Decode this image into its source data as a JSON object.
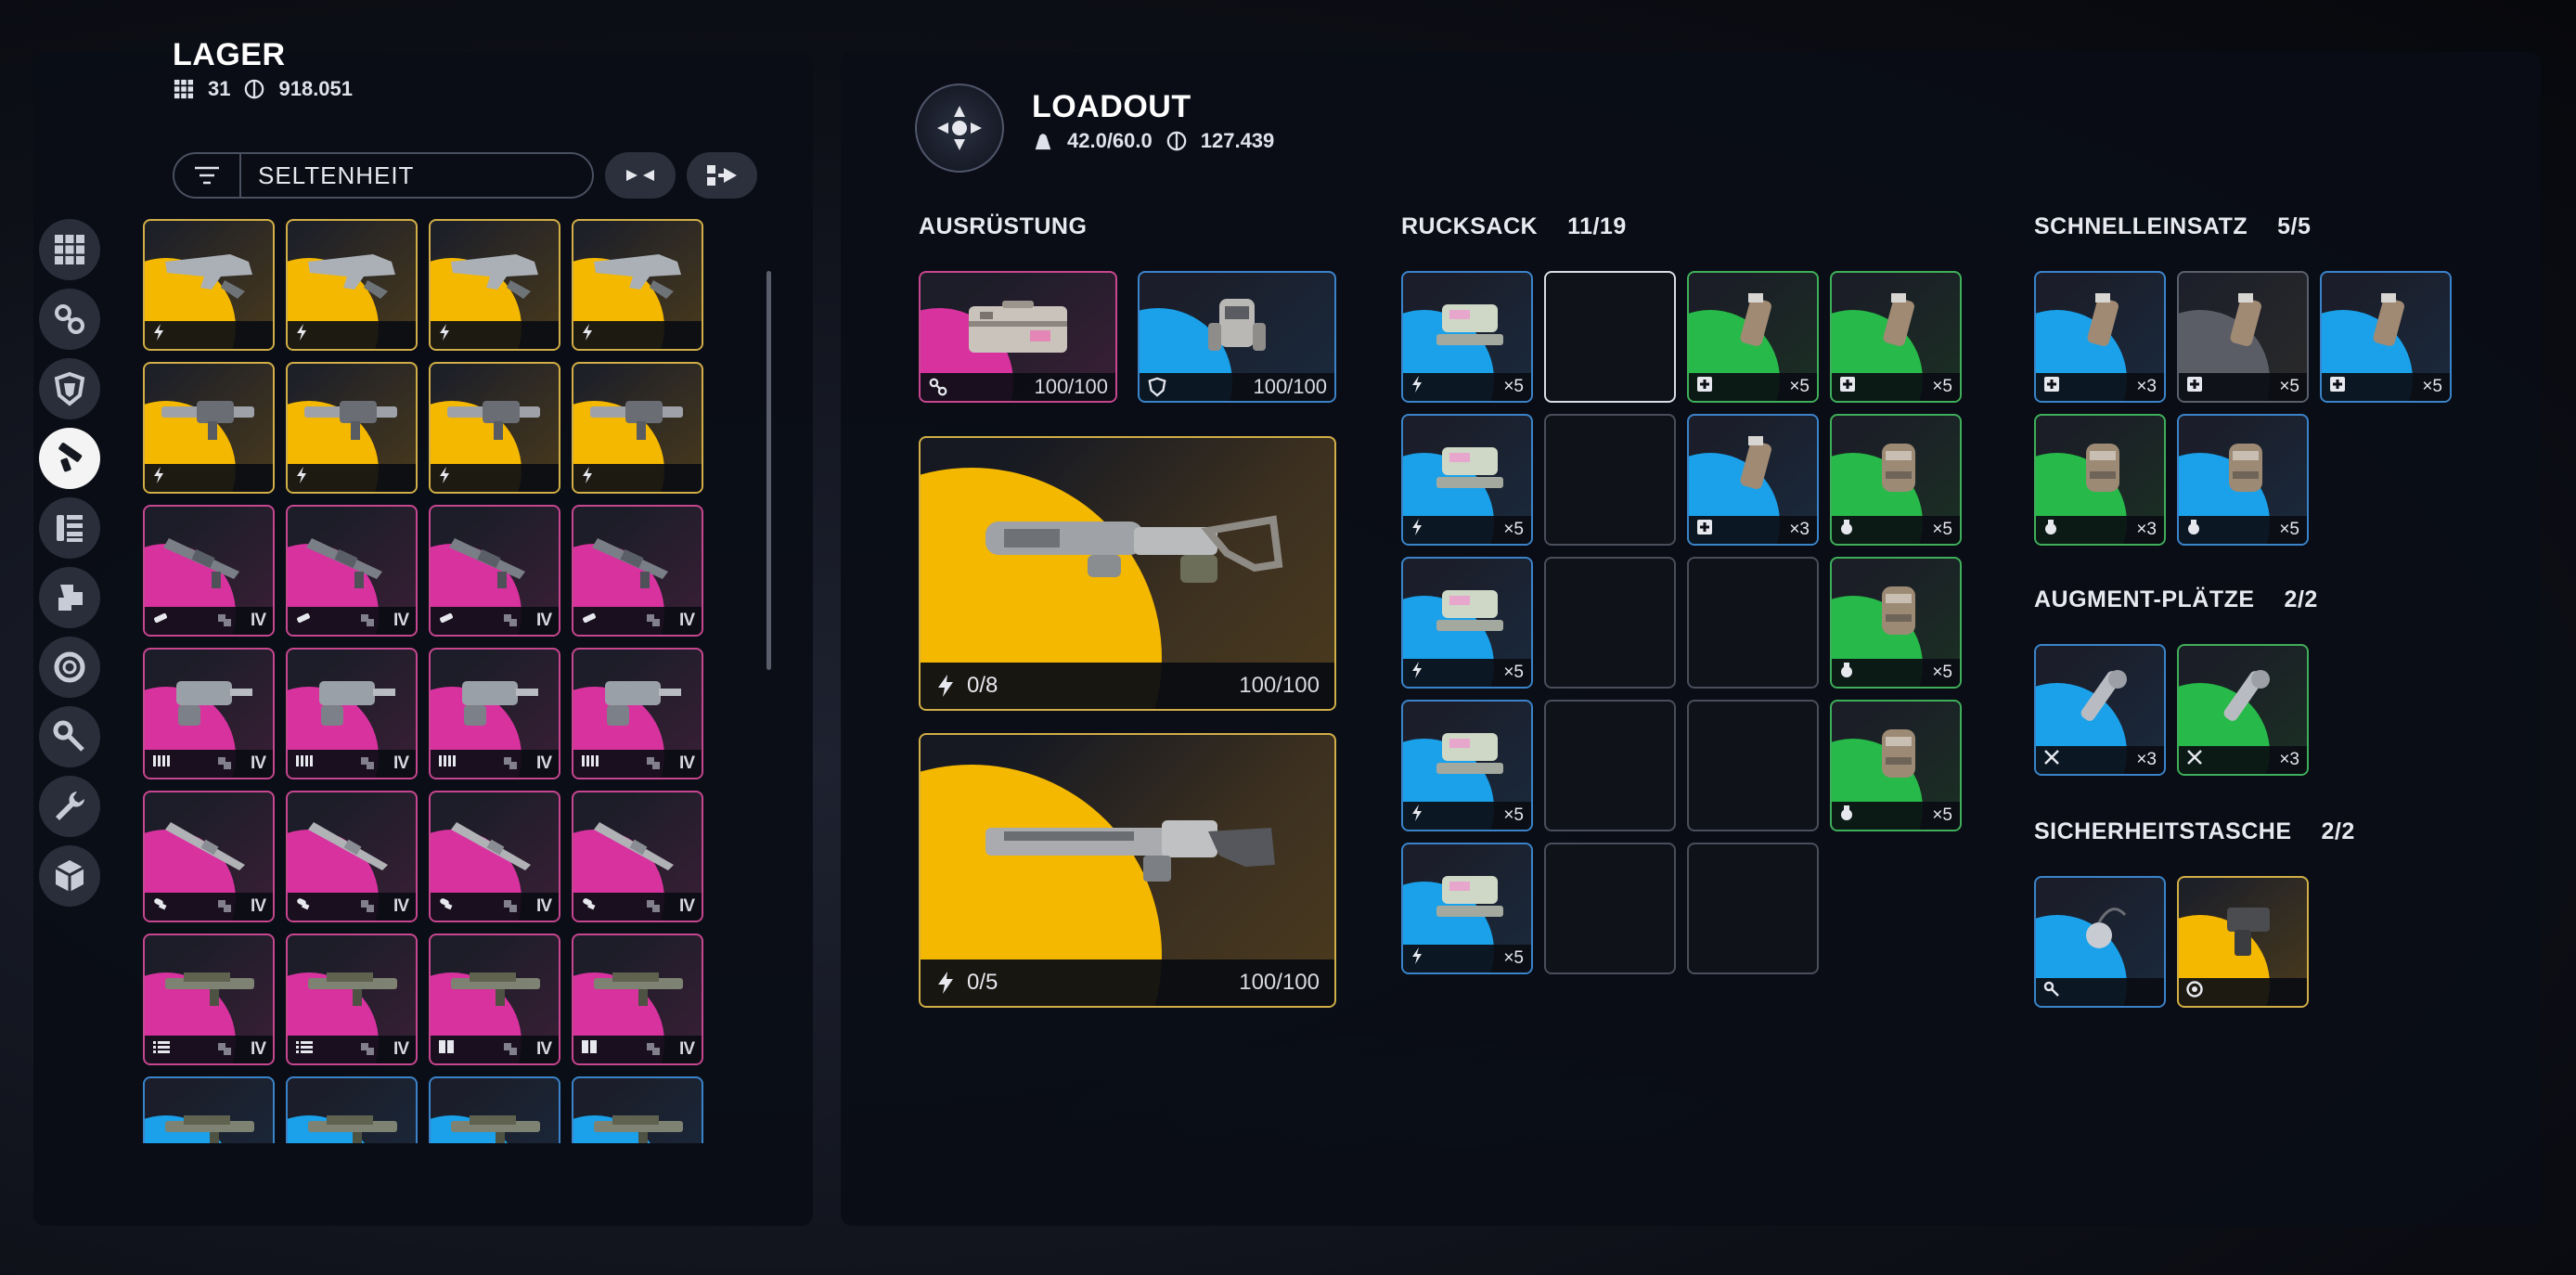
{
  "lager": {
    "title": "LAGER",
    "slots_count": "31",
    "credits": "918.051",
    "filter_label": "SELTENHEIT"
  },
  "categories": [
    {
      "name": "all",
      "icon": "grid-icon"
    },
    {
      "name": "augments",
      "icon": "augment-icon"
    },
    {
      "name": "shields",
      "icon": "shield-icon"
    },
    {
      "name": "weapons",
      "icon": "gun-icon",
      "active": true
    },
    {
      "name": "ammo",
      "icon": "ammo-icon"
    },
    {
      "name": "mods",
      "icon": "mod-icon"
    },
    {
      "name": "quick-use",
      "icon": "ring-icon"
    },
    {
      "name": "keys",
      "icon": "key-icon"
    },
    {
      "name": "materials",
      "icon": "wrench-icon"
    },
    {
      "name": "misc",
      "icon": "box-icon"
    }
  ],
  "lager_items": [
    {
      "rarity": "gold",
      "badge": "bolt",
      "tier": ""
    },
    {
      "rarity": "gold",
      "badge": "bolt",
      "tier": ""
    },
    {
      "rarity": "gold",
      "badge": "bolt",
      "tier": ""
    },
    {
      "rarity": "gold",
      "badge": "bolt",
      "tier": ""
    },
    {
      "rarity": "gold",
      "badge": "bolt",
      "tier": ""
    },
    {
      "rarity": "gold",
      "badge": "bolt",
      "tier": ""
    },
    {
      "rarity": "gold",
      "badge": "bolt",
      "tier": ""
    },
    {
      "rarity": "gold",
      "badge": "bolt",
      "tier": ""
    },
    {
      "rarity": "pink",
      "badge": "syringe",
      "tier": "IV"
    },
    {
      "rarity": "pink",
      "badge": "syringe",
      "tier": "IV"
    },
    {
      "rarity": "pink",
      "badge": "syringe",
      "tier": "IV"
    },
    {
      "rarity": "pink",
      "badge": "syringe",
      "tier": "IV"
    },
    {
      "rarity": "pink",
      "badge": "bars",
      "tier": "IV"
    },
    {
      "rarity": "pink",
      "badge": "bars",
      "tier": "IV"
    },
    {
      "rarity": "pink",
      "badge": "bars",
      "tier": "IV"
    },
    {
      "rarity": "pink",
      "badge": "bars",
      "tier": "IV"
    },
    {
      "rarity": "pink",
      "badge": "shell",
      "tier": "IV"
    },
    {
      "rarity": "pink",
      "badge": "shell",
      "tier": "IV"
    },
    {
      "rarity": "pink",
      "badge": "shell",
      "tier": "IV"
    },
    {
      "rarity": "pink",
      "badge": "shell",
      "tier": "IV"
    },
    {
      "rarity": "pink",
      "badge": "list",
      "tier": "IV"
    },
    {
      "rarity": "pink",
      "badge": "list",
      "tier": "IV"
    },
    {
      "rarity": "pink",
      "badge": "block",
      "tier": "IV"
    },
    {
      "rarity": "pink",
      "badge": "block",
      "tier": "IV"
    },
    {
      "rarity": "blue",
      "badge": "",
      "tier": ""
    },
    {
      "rarity": "blue",
      "badge": "",
      "tier": ""
    },
    {
      "rarity": "blue",
      "badge": "",
      "tier": ""
    },
    {
      "rarity": "blue",
      "badge": "",
      "tier": ""
    }
  ],
  "loadout": {
    "title": "LOADOUT",
    "weight": "42.0/60.0",
    "value": "127.439"
  },
  "ausruestung": {
    "label": "AUSRÜSTUNG",
    "augment": {
      "rarity": "pink",
      "durability": "100/100"
    },
    "shield": {
      "rarity": "blue",
      "durability": "100/100"
    },
    "weapon1": {
      "ammo": "0/8",
      "durability": "100/100"
    },
    "weapon2": {
      "ammo": "0/5",
      "durability": "100/100"
    }
  },
  "rucksack": {
    "label": "RUCKSACK",
    "count": "11/19",
    "slots": [
      {
        "rarity": "blue",
        "badge": "bolt",
        "qty": "×5"
      },
      {
        "rarity": "empty",
        "selected": true
      },
      {
        "rarity": "green",
        "badge": "plus",
        "qty": "×5"
      },
      {
        "rarity": "green",
        "badge": "plus",
        "qty": "×5"
      },
      {
        "rarity": "blue",
        "badge": "bolt",
        "qty": "×5"
      },
      {
        "rarity": "empty"
      },
      {
        "rarity": "blue",
        "badge": "plus",
        "qty": "×3"
      },
      {
        "rarity": "green",
        "badge": "grenade",
        "qty": "×5"
      },
      {
        "rarity": "blue",
        "badge": "bolt",
        "qty": "×5"
      },
      {
        "rarity": "empty"
      },
      {
        "rarity": "empty"
      },
      {
        "rarity": "green",
        "badge": "grenade",
        "qty": "×5"
      },
      {
        "rarity": "blue",
        "badge": "bolt",
        "qty": "×5"
      },
      {
        "rarity": "empty"
      },
      {
        "rarity": "empty"
      },
      {
        "rarity": "green",
        "badge": "grenade",
        "qty": "×5"
      },
      {
        "rarity": "blue",
        "badge": "bolt",
        "qty": "×5"
      },
      {
        "rarity": "empty"
      },
      {
        "rarity": "empty"
      }
    ]
  },
  "schnelleinsatz": {
    "label": "SCHNELLEINSATZ",
    "count": "5/5",
    "slots": [
      {
        "rarity": "blue",
        "badge": "plus",
        "qty": "×3"
      },
      {
        "rarity": "grey",
        "badge": "plus",
        "qty": "×5"
      },
      {
        "rarity": "blue",
        "badge": "plus",
        "qty": "×5"
      },
      {
        "rarity": "green",
        "badge": "grenade",
        "qty": "×3"
      },
      {
        "rarity": "blue",
        "badge": "grenade",
        "qty": "×5"
      }
    ]
  },
  "augment_plaetze": {
    "label": "AUGMENT-PLÄTZE",
    "count": "2/2",
    "slots": [
      {
        "rarity": "blue",
        "badge": "tools",
        "qty": "×3"
      },
      {
        "rarity": "green",
        "badge": "tools",
        "qty": "×3"
      }
    ]
  },
  "sicherheitstasche": {
    "label": "SICHERHEITSTASCHE",
    "count": "2/2",
    "slots": [
      {
        "rarity": "blue",
        "badge": "key",
        "qty": ""
      },
      {
        "rarity": "gold",
        "badge": "aperture",
        "qty": ""
      }
    ]
  },
  "colors": {
    "gold": "#f5b800",
    "pink": "#d8329f",
    "blue": "#1aa1ea",
    "green": "#27b949",
    "grey": "#5a5d66"
  }
}
